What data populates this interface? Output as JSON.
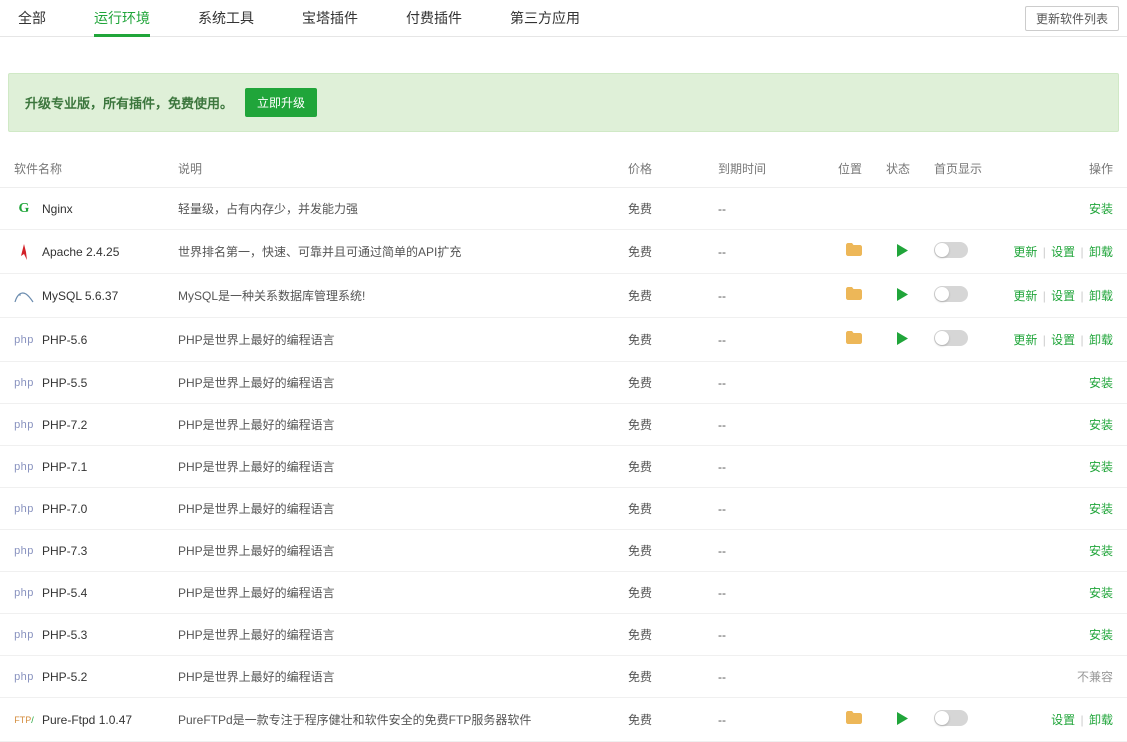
{
  "tabs": [
    "全部",
    "运行环境",
    "系统工具",
    "宝塔插件",
    "付费插件",
    "第三方应用"
  ],
  "activeTab": 1,
  "updateBtn": "更新软件列表",
  "banner": {
    "text": "升级专业版，所有插件，免费使用。",
    "btn": "立即升级"
  },
  "headers": {
    "name": "软件名称",
    "desc": "说明",
    "price": "价格",
    "expire": "到期时间",
    "loc": "位置",
    "status": "状态",
    "home": "首页显示",
    "ops": "操作"
  },
  "labels": {
    "install": "安装",
    "update": "更新",
    "settings": "设置",
    "uninstall": "卸载",
    "incompatible": "不兼容"
  },
  "rows": [
    {
      "icon": "nginx",
      "name": "Nginx",
      "desc": "轻量级，占有内存少，并发能力强",
      "price": "免费",
      "expire": "--",
      "installed": false,
      "ops": [
        "install"
      ]
    },
    {
      "icon": "apache",
      "name": "Apache 2.4.25",
      "desc": "世界排名第一，快速、可靠并且可通过简单的API扩充",
      "price": "免费",
      "expire": "--",
      "installed": true,
      "ops": [
        "update",
        "settings",
        "uninstall"
      ]
    },
    {
      "icon": "mysql",
      "name": "MySQL 5.6.37",
      "desc": "MySQL是一种关系数据库管理系统!",
      "price": "免费",
      "expire": "--",
      "installed": true,
      "ops": [
        "update",
        "settings",
        "uninstall"
      ]
    },
    {
      "icon": "php",
      "name": "PHP-5.6",
      "desc": "PHP是世界上最好的编程语言",
      "price": "免费",
      "expire": "--",
      "installed": true,
      "ops": [
        "update",
        "settings",
        "uninstall"
      ]
    },
    {
      "icon": "php",
      "name": "PHP-5.5",
      "desc": "PHP是世界上最好的编程语言",
      "price": "免费",
      "expire": "--",
      "installed": false,
      "ops": [
        "install"
      ]
    },
    {
      "icon": "php",
      "name": "PHP-7.2",
      "desc": "PHP是世界上最好的编程语言",
      "price": "免费",
      "expire": "--",
      "installed": false,
      "ops": [
        "install"
      ]
    },
    {
      "icon": "php",
      "name": "PHP-7.1",
      "desc": "PHP是世界上最好的编程语言",
      "price": "免费",
      "expire": "--",
      "installed": false,
      "ops": [
        "install"
      ]
    },
    {
      "icon": "php",
      "name": "PHP-7.0",
      "desc": "PHP是世界上最好的编程语言",
      "price": "免费",
      "expire": "--",
      "installed": false,
      "ops": [
        "install"
      ]
    },
    {
      "icon": "php",
      "name": "PHP-7.3",
      "desc": "PHP是世界上最好的编程语言",
      "price": "免费",
      "expire": "--",
      "installed": false,
      "ops": [
        "install"
      ]
    },
    {
      "icon": "php",
      "name": "PHP-5.4",
      "desc": "PHP是世界上最好的编程语言",
      "price": "免费",
      "expire": "--",
      "installed": false,
      "ops": [
        "install"
      ]
    },
    {
      "icon": "php",
      "name": "PHP-5.3",
      "desc": "PHP是世界上最好的编程语言",
      "price": "免费",
      "expire": "--",
      "installed": false,
      "ops": [
        "install"
      ]
    },
    {
      "icon": "php",
      "name": "PHP-5.2",
      "desc": "PHP是世界上最好的编程语言",
      "price": "免费",
      "expire": "--",
      "installed": false,
      "ops": [
        "incompatible"
      ]
    },
    {
      "icon": "ftp",
      "name": "Pure-Ftpd 1.0.47",
      "desc": "PureFTPd是一款专注于程序健壮和软件安全的免费FTP服务器软件",
      "price": "免费",
      "expire": "--",
      "installed": true,
      "ops": [
        "settings",
        "uninstall"
      ]
    }
  ]
}
